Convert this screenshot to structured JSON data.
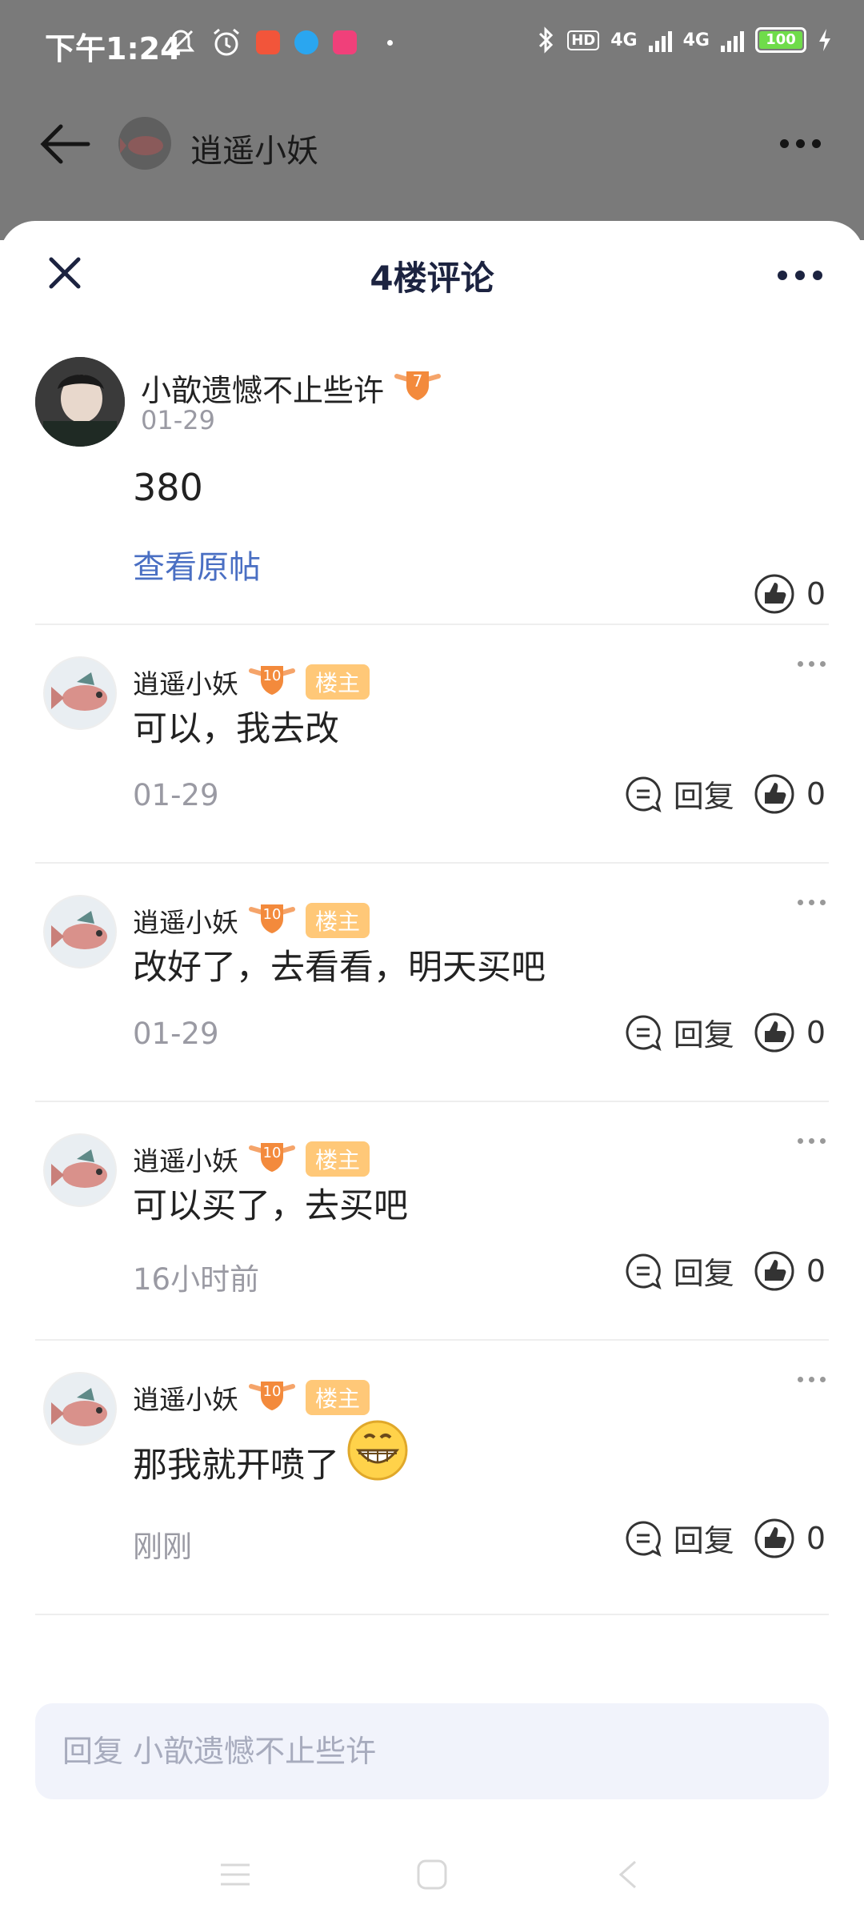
{
  "status_bar": {
    "time": "下午1:24",
    "network_1": "4G",
    "network_2": "4G",
    "battery": "100",
    "hd": "HD"
  },
  "background_page": {
    "title": "逍遥小妖"
  },
  "sheet": {
    "title": "4楼评论"
  },
  "main_post": {
    "author": "小歆遗憾不止些许",
    "level": "7",
    "date": "01-29",
    "text": "380",
    "view_original": "查看原帖",
    "likes": "0"
  },
  "comments": [
    {
      "author": "逍遥小妖",
      "level": "10",
      "badge": "楼主",
      "text": "可以，我去改",
      "date": "01-29",
      "reply_label": "回复",
      "likes": "0"
    },
    {
      "author": "逍遥小妖",
      "level": "10",
      "badge": "楼主",
      "text": "改好了，去看看，明天买吧",
      "date": "01-29",
      "reply_label": "回复",
      "likes": "0"
    },
    {
      "author": "逍遥小妖",
      "level": "10",
      "badge": "楼主",
      "text": "可以买了，去买吧",
      "date": "16小时前",
      "reply_label": "回复",
      "likes": "0"
    },
    {
      "author": "逍遥小妖",
      "level": "10",
      "badge": "楼主",
      "text": "那我就开喷了",
      "emoji": "grinning-emoji",
      "date": "刚刚",
      "reply_label": "回复",
      "likes": "0"
    }
  ],
  "reply_input": {
    "placeholder": "回复 小歆遗憾不止些许"
  },
  "colors": {
    "accent_link": "#4a6fc3",
    "owner_badge": "#ffc878",
    "level_badge": "#f38a3c",
    "title_text": "#1c2340"
  }
}
